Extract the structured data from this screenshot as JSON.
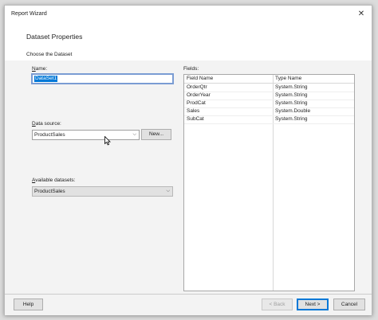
{
  "window": {
    "title": "Report Wizard",
    "close_glyph": "✕"
  },
  "header": {
    "title": "Dataset Properties",
    "subtitle": "Choose the Dataset"
  },
  "name_field": {
    "label_accel": "N",
    "label_rest": "ame:",
    "value": "DataSet1"
  },
  "data_source": {
    "label_accel": "D",
    "label_rest": "ata source:",
    "value": "ProductSales",
    "new_button": "New..."
  },
  "available_datasets": {
    "label_accel": "A",
    "label_rest": "vailable datasets:",
    "value": "ProductSales"
  },
  "fields": {
    "label": "Fields:",
    "columns": [
      "Field Name",
      "Type Name"
    ],
    "rows": [
      [
        "OrderQtr",
        "System.String"
      ],
      [
        "OrderYear",
        "System.String"
      ],
      [
        "ProdCat",
        "System.String"
      ],
      [
        "Sales",
        "System.Double"
      ],
      [
        "SubCat",
        "System.String"
      ]
    ]
  },
  "footer": {
    "help": "Help",
    "back": "< Back",
    "next": "Next >",
    "cancel": "Cancel"
  },
  "icons": {
    "chevron": "chevron-down-icon",
    "close": "close-icon",
    "cursor": "mouse-cursor-icon"
  }
}
